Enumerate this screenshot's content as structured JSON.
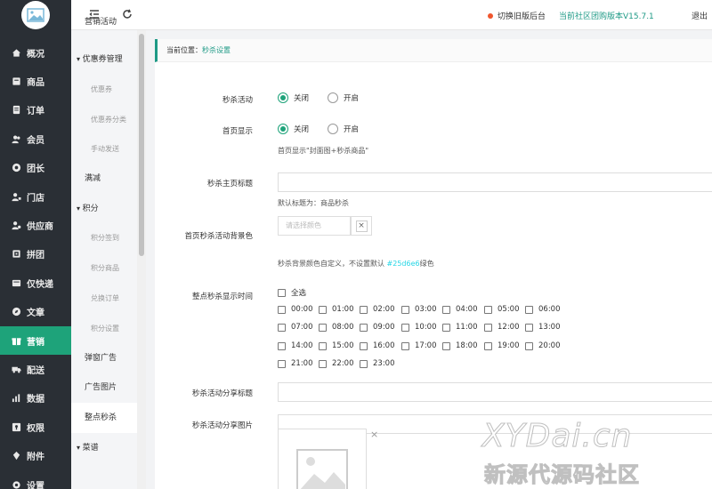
{
  "sidebar": {
    "items": [
      {
        "label": "概况",
        "icon": "home-icon"
      },
      {
        "label": "商品",
        "icon": "goods-icon"
      },
      {
        "label": "订单",
        "icon": "order-icon"
      },
      {
        "label": "会员",
        "icon": "member-icon"
      },
      {
        "label": "团长",
        "icon": "leader-icon"
      },
      {
        "label": "门店",
        "icon": "store-icon"
      },
      {
        "label": "供应商",
        "icon": "supplier-icon"
      },
      {
        "label": "拼团",
        "icon": "group-buy-icon"
      },
      {
        "label": "仅快递",
        "icon": "express-icon"
      },
      {
        "label": "文章",
        "icon": "article-icon"
      },
      {
        "label": "营销",
        "icon": "marketing-icon"
      },
      {
        "label": "配送",
        "icon": "delivery-icon"
      },
      {
        "label": "数据",
        "icon": "data-icon"
      },
      {
        "label": "权限",
        "icon": "permission-icon"
      },
      {
        "label": "附件",
        "icon": "attachment-icon"
      },
      {
        "label": "设置",
        "icon": "settings-icon"
      }
    ],
    "active_label": "营销"
  },
  "submenu": {
    "items": [
      {
        "label": "营销活动",
        "type": "lvl1"
      },
      {
        "label": "优惠券管理",
        "type": "group"
      },
      {
        "label": "优惠券",
        "type": "lvl2"
      },
      {
        "label": "优惠券分类",
        "type": "lvl2"
      },
      {
        "label": "手动发送",
        "type": "lvl2"
      },
      {
        "label": "满减",
        "type": "lvl1"
      },
      {
        "label": "积分",
        "type": "group"
      },
      {
        "label": "积分签到",
        "type": "lvl2"
      },
      {
        "label": "积分商品",
        "type": "lvl2"
      },
      {
        "label": "兑换订单",
        "type": "lvl2"
      },
      {
        "label": "积分设置",
        "type": "lvl2"
      },
      {
        "label": "弹窗广告",
        "type": "lvl1"
      },
      {
        "label": "广告图片",
        "type": "lvl1"
      },
      {
        "label": "整点秒杀",
        "type": "lvl1",
        "active": true
      },
      {
        "label": "菜谱",
        "type": "group"
      }
    ]
  },
  "header": {
    "old_version_label": "切换旧版后台",
    "version_label": "当前社区团购版本V15.7.1",
    "logout_label": "退出"
  },
  "breadcrumb": {
    "prefix": "当前位置：",
    "current": "秒杀设置"
  },
  "form": {
    "seckill_activity": {
      "label": "秒杀活动",
      "options": [
        "关闭",
        "开启"
      ],
      "selected": "关闭"
    },
    "home_display": {
      "label": "首页显示",
      "options": [
        "关闭",
        "开启"
      ],
      "selected": "关闭",
      "hint": "首页显示\"封面图+秒杀商品\""
    },
    "home_title": {
      "label": "秒杀主页标题",
      "value": "",
      "hint": "默认标题为：商品秒杀"
    },
    "bg_color": {
      "label": "首页秒杀活动背景色",
      "placeholder": "请选择颜色",
      "clear_symbol": "×",
      "hint_prefix": "秒杀背景颜色自定义，不设置默认",
      "hint_color": "#25d6e6",
      "hint_suffix": "绿色"
    },
    "display_time": {
      "label": "整点秒杀显示时间",
      "select_all": "全选",
      "hours": [
        "00:00",
        "01:00",
        "02:00",
        "03:00",
        "04:00",
        "05:00",
        "06:00",
        "07:00",
        "08:00",
        "09:00",
        "10:00",
        "11:00",
        "12:00",
        "13:00",
        "14:00",
        "15:00",
        "16:00",
        "17:00",
        "18:00",
        "19:00",
        "20:00",
        "21:00",
        "22:00",
        "23:00"
      ]
    },
    "share_title": {
      "label": "秒杀活动分享标题",
      "value": ""
    },
    "share_image": {
      "label": "秒杀活动分享图片",
      "close_symbol": "×"
    }
  },
  "watermark": {
    "line1": "XYDai.cn",
    "line2": "新源代源码社区"
  },
  "colors": {
    "sidebar_bg": "#2a2f35",
    "accent": "#1ea37a",
    "link": "#1e9a86",
    "dot": "#f0562e"
  }
}
